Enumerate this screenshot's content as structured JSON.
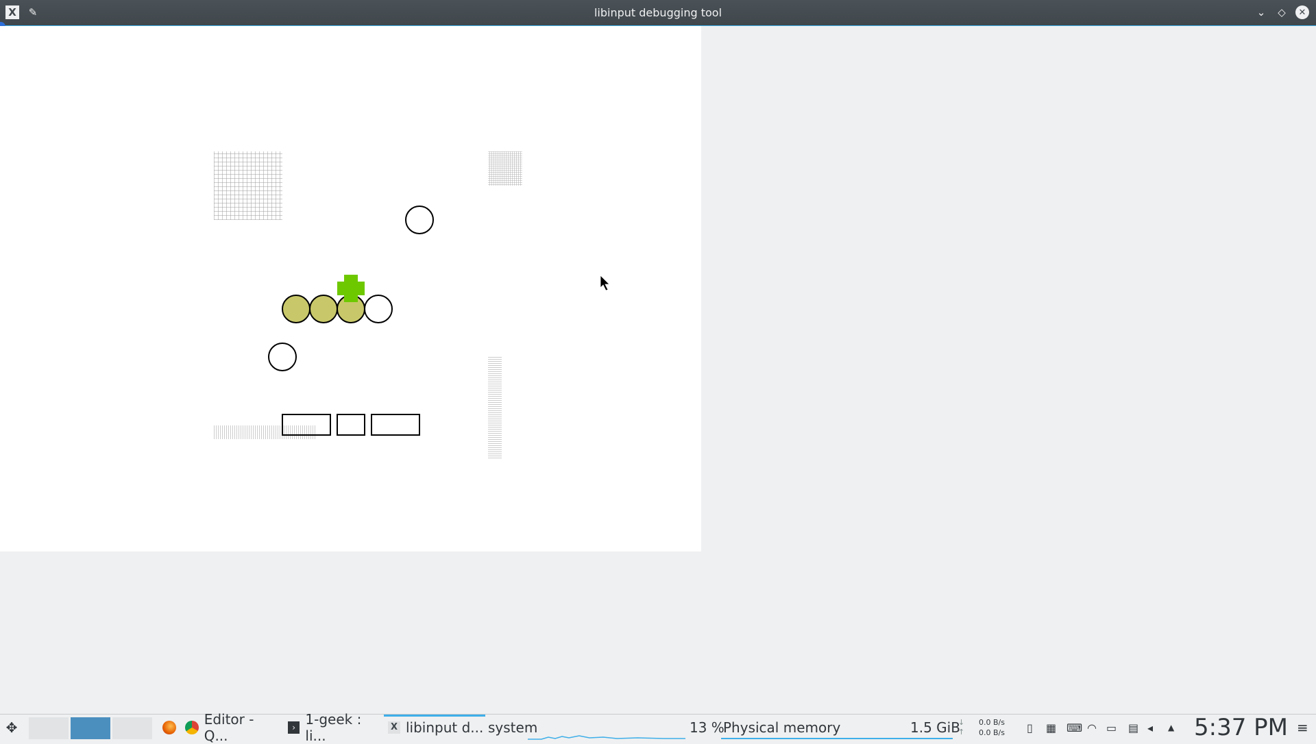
{
  "window": {
    "title": "libinput debugging tool",
    "app_icon_glyph": "X",
    "pin_glyph": "✎",
    "minimize_glyph": "⌄",
    "maximize_glyph": "◇",
    "close_glyph": "✕"
  },
  "taskbar": {
    "launcher_glyph": "✥",
    "tasks": [
      {
        "label": "Editor - Q...",
        "icon": "chrome-icon"
      },
      {
        "label": "1-geek : li...",
        "icon": "terminal-icon"
      },
      {
        "label": "libinput d...",
        "icon": "x11-icon",
        "active": true
      }
    ],
    "system_monitor": {
      "cpu_label": "system",
      "memory_percent": "13 %",
      "memory_label": "Physical memory",
      "memory_used": "1.5 GiB",
      "net_down": "0.0 B/s",
      "net_up": "0.0 B/s"
    },
    "clock": "5:37 PM",
    "menu_glyph": "≡"
  },
  "colors": {
    "accent": "#3daee9",
    "touch_fill": "#c8c86a",
    "cross": "#6ec800",
    "titlebar": "#454c51"
  }
}
